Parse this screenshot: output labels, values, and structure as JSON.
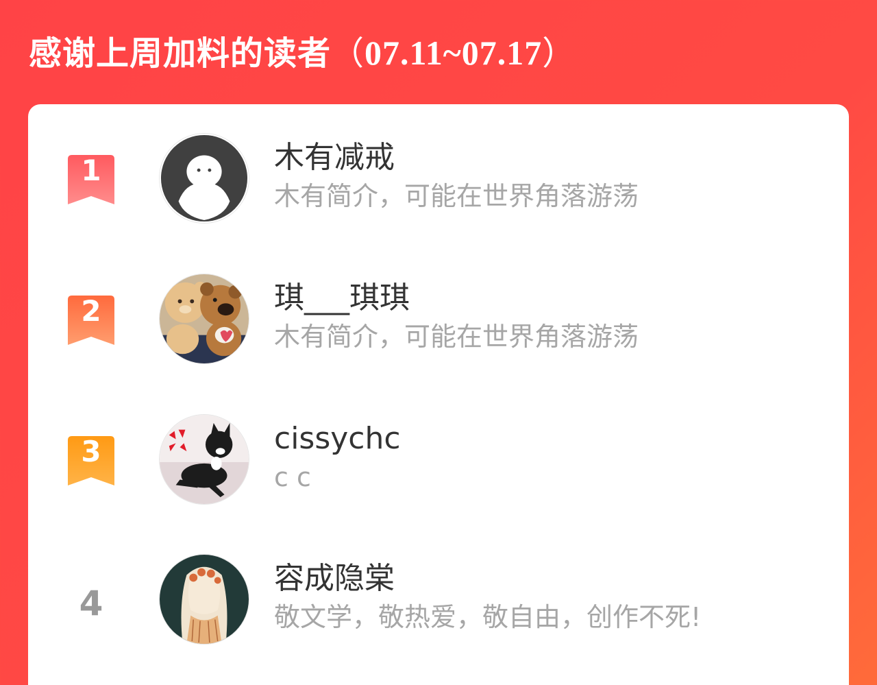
{
  "header": {
    "title_prefix": "感谢上周加料的读者",
    "open_paren": "（",
    "date_range": "07.11~07.17",
    "close_paren": "）"
  },
  "readers": [
    {
      "rank": "1",
      "name": "木有减戒",
      "bio": "木有简介，可能在世界角落游荡",
      "badge_color_top": "#ff6b6b",
      "badge_color_bottom": "#ff8a8a"
    },
    {
      "rank": "2",
      "name": "琪___琪琪",
      "bio": "木有简介，可能在世界角落游荡",
      "badge_color_top": "#ff7a45",
      "badge_color_bottom": "#ff9a6a"
    },
    {
      "rank": "3",
      "name": "cissychc",
      "bio": "c c",
      "badge_color_top": "#ff9f1a",
      "badge_color_bottom": "#ffb84d"
    },
    {
      "rank": "4",
      "name": "容成隐棠",
      "bio": "敬文学，敬热爱，敬自由，创作不死!"
    }
  ]
}
